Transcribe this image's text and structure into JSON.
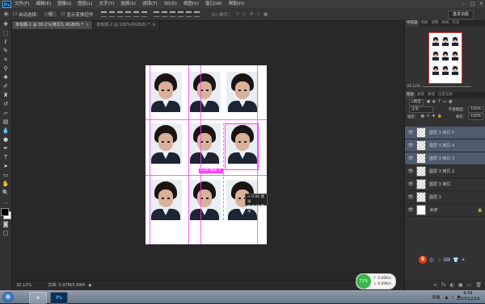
{
  "menubar": {
    "logo": "Ps",
    "items": [
      "文件(F)",
      "编辑(E)",
      "图像(I)",
      "图层(L)",
      "文字(Y)",
      "选择(S)",
      "滤镜(T)",
      "3D(D)",
      "视图(V)",
      "窗口(W)",
      "帮助(H)"
    ],
    "window_controls": [
      "–",
      "□",
      "×"
    ]
  },
  "options": {
    "auto_select_label": "自动选择：",
    "auto_select_value": "组",
    "show_transform_label": "显示变换控件",
    "mode_3d_label": "3D 模式：",
    "workspace": "基本功能"
  },
  "tabs": [
    {
      "label": "未标题-1 @ 30.1%(拷贝3, RGB/8) *",
      "active": true
    },
    {
      "label": "未标题-2 @ 100%(RGB/8) *",
      "active": false
    }
  ],
  "canvas": {
    "measure_label": "6.64 厘米 ↕",
    "readout_1": "↔ 0.00 厘米",
    "readout_2": "↕ 4.44 厘米"
  },
  "status": {
    "zoom": "30.12%",
    "doc": "文档: 5.97M/5.99M"
  },
  "right_panel": {
    "top_tabs": [
      "导航器",
      "色板",
      "调整",
      "样式",
      "历史"
    ],
    "nav_zoom": "30.12%",
    "layer_tabs": [
      "图层",
      "通道",
      "路径",
      "历史记录"
    ],
    "kind_label": "ρ类型",
    "blend_mode": "正常",
    "opacity_label": "不透明度：",
    "opacity_value": "100%",
    "lock_label": "锁定：",
    "fill_label": "填充：",
    "fill_value": "100%",
    "layers": [
      {
        "name": "图层 3 拷贝 5",
        "selected": true
      },
      {
        "name": "图层 3 拷贝 4",
        "selected": true
      },
      {
        "name": "图层 3 拷贝 3",
        "selected": true
      },
      {
        "name": "图层 3 拷贝 2",
        "selected": false
      },
      {
        "name": "图层 3 拷贝",
        "selected": false
      },
      {
        "name": "图层 3",
        "selected": false
      },
      {
        "name": "背景",
        "selected": false,
        "locked": true
      }
    ],
    "ime_logo": "S",
    "footer_icons": [
      "∞",
      "fx",
      "◐",
      "▣",
      "▭",
      "🗑"
    ]
  },
  "speed_widget": {
    "percent": "71%",
    "up": "↑ 0.00K/s",
    "down": "↓ 0.00K/s"
  },
  "taskbar": {
    "start": "⊞",
    "tray_label": "桌面",
    "time": "9:58",
    "date": "2015/12/19"
  },
  "colors": {
    "guide": "#ff3cff",
    "panel": "#323232",
    "selected_layer": "#4e5a6e"
  }
}
